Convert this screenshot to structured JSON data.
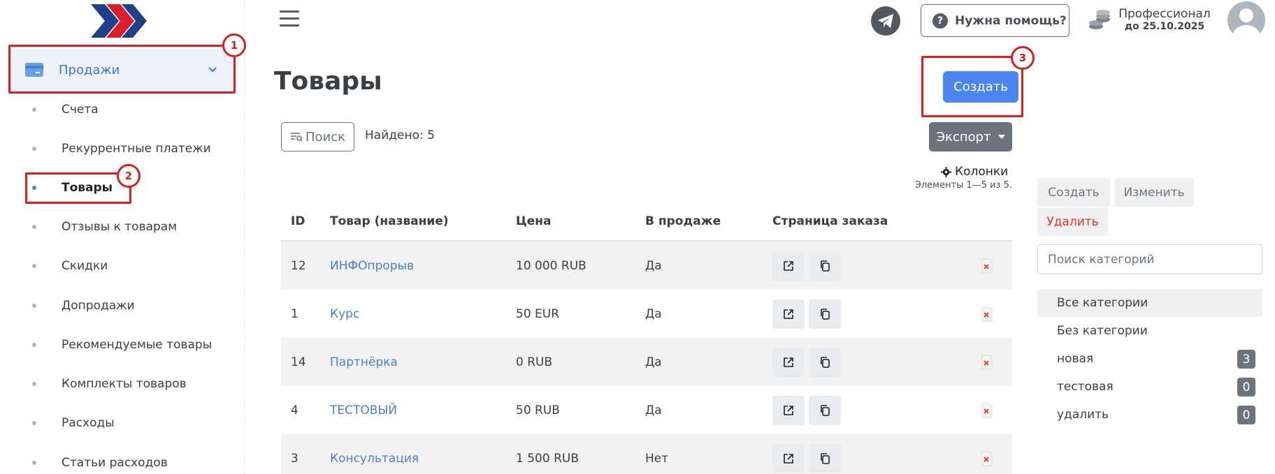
{
  "sidebar": {
    "parent_label": "Продажи",
    "items": [
      {
        "label": "Счета"
      },
      {
        "label": "Рекуррентные платежи"
      },
      {
        "label": "Товары"
      },
      {
        "label": "Отзывы к товарам"
      },
      {
        "label": "Скидки"
      },
      {
        "label": "Допродажи"
      },
      {
        "label": "Рекомендуемые товары"
      },
      {
        "label": "Комплекты товаров"
      },
      {
        "label": "Расходы"
      },
      {
        "label": "Статьи расходов"
      }
    ],
    "active_item": "Товары"
  },
  "header": {
    "help_label": "Нужна помощь?",
    "plan_name": "Профессионал",
    "plan_until": "до 25.10.2025"
  },
  "annotations": [
    "1",
    "2",
    "3"
  ],
  "main": {
    "title": "Товары",
    "create_label": "Создать",
    "search_label": "Поиск",
    "found_text": "Найдено: 5",
    "export_label": "Экспорт",
    "columns_label": "Колонки",
    "elements_text": "Элементы 1—5 из 5."
  },
  "table": {
    "headers": [
      "ID",
      "Товар (название)",
      "Цена",
      "В продаже",
      "Страница заказа"
    ],
    "rows": [
      {
        "id": "12",
        "name": "ИНФОпрорыв",
        "price": "10 000 RUB",
        "on_sale": "Да"
      },
      {
        "id": "1",
        "name": "Курс",
        "price": "50 EUR",
        "on_sale": "Да"
      },
      {
        "id": "14",
        "name": "Партнёрка",
        "price": "0 RUB",
        "on_sale": "Да"
      },
      {
        "id": "4",
        "name": "ТЕСТОВЫЙ",
        "price": "50 RUB",
        "on_sale": "Да"
      },
      {
        "id": "3",
        "name": "Консультация",
        "price": "1 500 RUB",
        "on_sale": "Нет"
      }
    ]
  },
  "categories": {
    "create_label": "Создать",
    "edit_label": "Изменить",
    "delete_label": "Удалить",
    "search_placeholder": "Поиск категорий",
    "items": [
      {
        "label": "Все категории",
        "count": ""
      },
      {
        "label": "Без категории",
        "count": ""
      },
      {
        "label": "новая",
        "count": "3"
      },
      {
        "label": "тестовая",
        "count": "0"
      },
      {
        "label": "удалить",
        "count": "0"
      }
    ]
  },
  "colors": {
    "accent": "#4b86f0",
    "link": "#4a7fd0",
    "annotation": "#d81f1f",
    "danger": "#d9352b"
  }
}
